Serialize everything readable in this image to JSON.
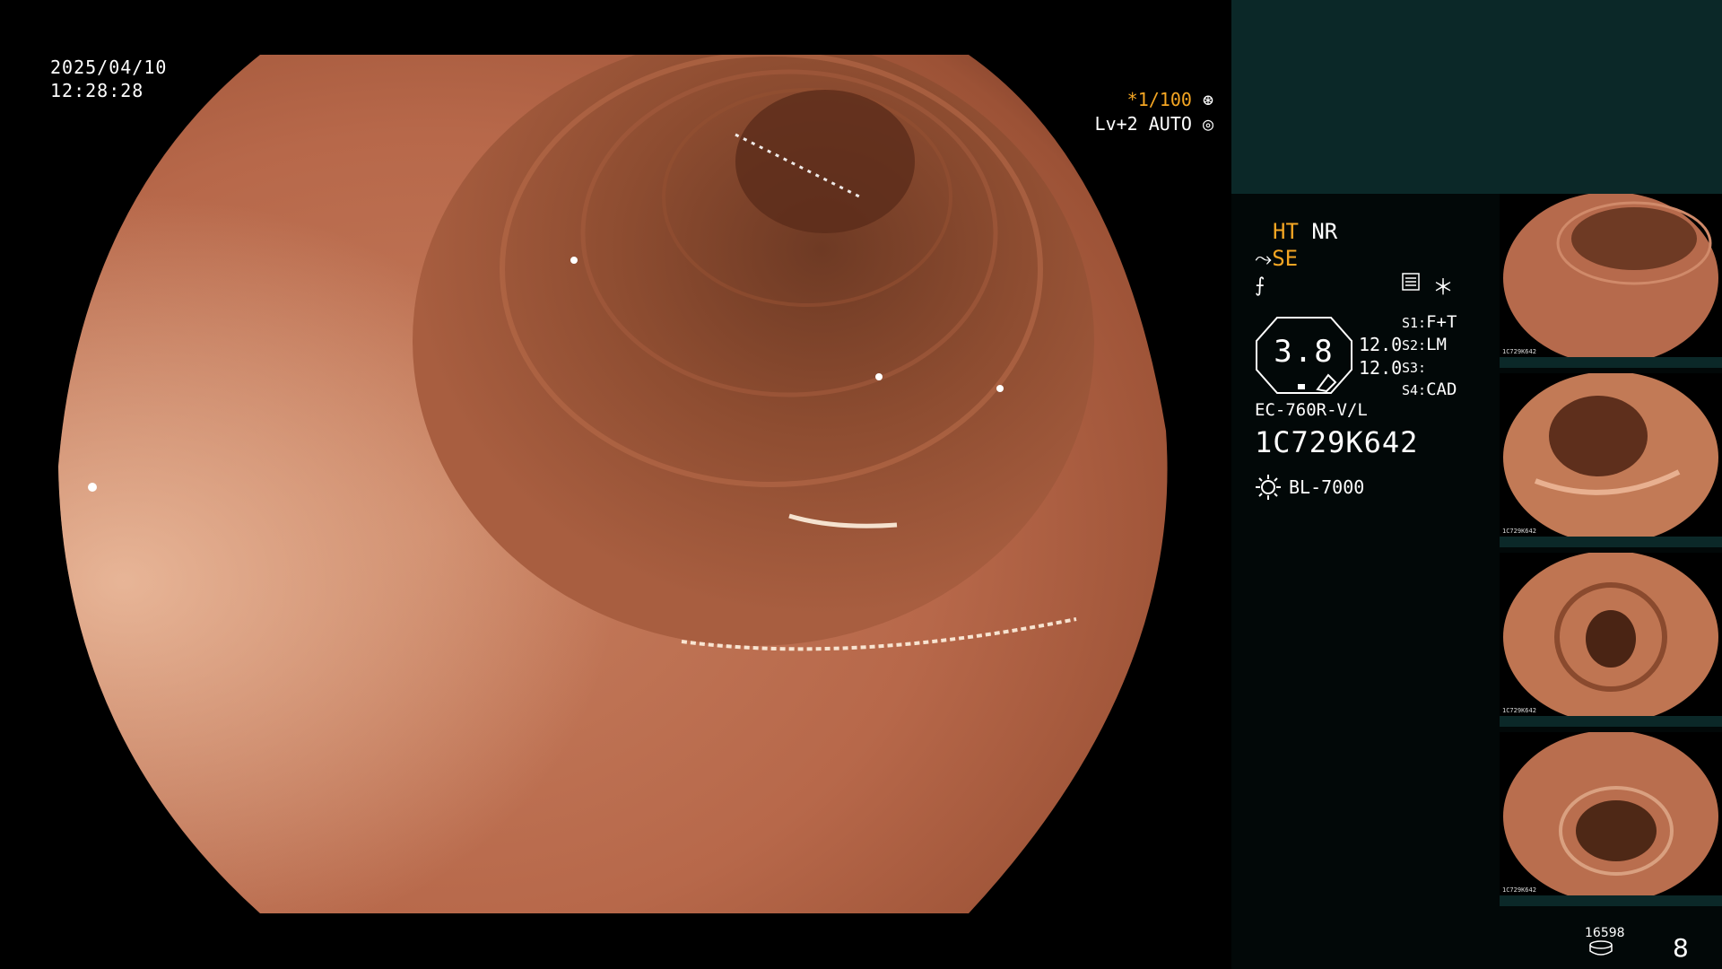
{
  "overlay": {
    "date": "2025/04/10",
    "time": "12:28:28",
    "shutter": "*1/100",
    "level": "Lv+2 AUTO"
  },
  "panel": {
    "ht": "HT",
    "nr": "NR",
    "se": "SE",
    "gauge_value": "3.8",
    "stat_top": "12.0",
    "stat_bottom": "12.0",
    "slots": [
      {
        "key": "S1:",
        "value": "F+T"
      },
      {
        "key": "S2:",
        "value": "LM"
      },
      {
        "key": "S3:",
        "value": ""
      },
      {
        "key": "S4:",
        "value": "CAD"
      }
    ],
    "scope_model": "EC-760R-V/L",
    "scope_serial": "1C729K642",
    "light_source": "BL-7000",
    "counter_small": "16598",
    "counter_big": "8"
  },
  "thumbnails": [
    {
      "label": "1C729K642"
    },
    {
      "label": "1C729K642"
    },
    {
      "label": "1C729K642"
    },
    {
      "label": "1C729K642"
    }
  ],
  "colors": {
    "accent": "#f5a623",
    "panel_top": "#0b2828",
    "panel_bg": "#020808"
  }
}
